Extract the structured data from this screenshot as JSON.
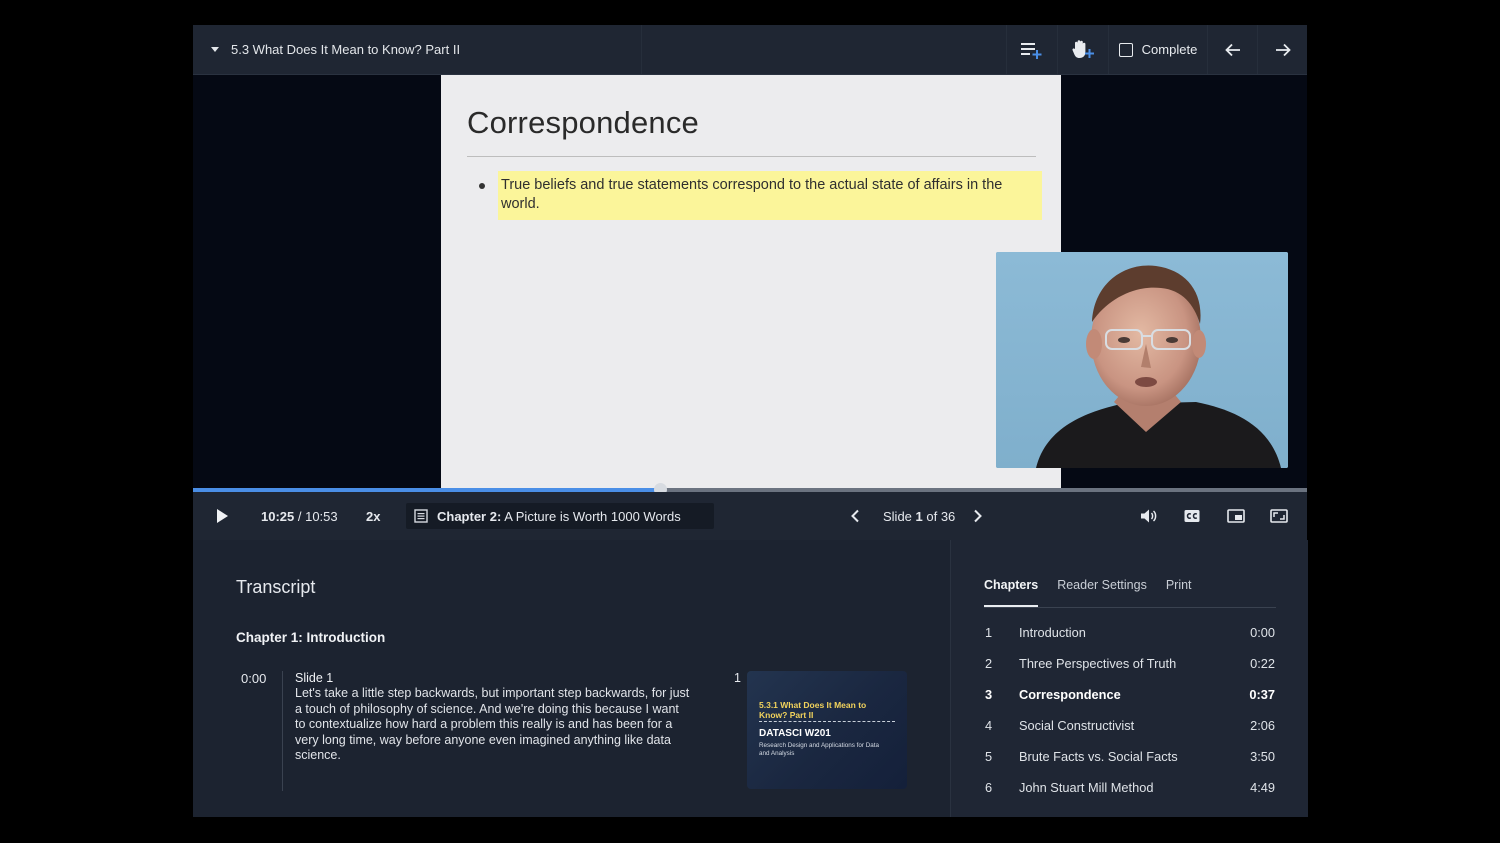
{
  "lesson": {
    "title": "5.3 What Does It Mean to Know? Part II",
    "complete_label": "Complete"
  },
  "slide": {
    "title": "Correspondence",
    "bullet": "True beliefs and true statements correspond to the actual state of affairs in the world."
  },
  "player": {
    "current_time": "10:25",
    "separator": " / ",
    "duration": "10:53",
    "progress": 0.42,
    "speed": "2x",
    "chapter_prefix": "Chapter 2:",
    "chapter_title": " A Picture is Worth 1000 Words",
    "slide_word": "Slide ",
    "slide_current": "1",
    "slide_of": " of 36"
  },
  "transcript": {
    "heading": "Transcript",
    "chapter_heading": "Chapter 1: Introduction",
    "entry": {
      "time": "0:00",
      "slide_label": "Slide 1",
      "text": "Let's take a little step backwards, but important step backwards, for just a touch of philosophy of science. And we're doing this because I want to contextualize how hard a problem this really is and has been for a very long time, way before anyone even imagined anything like data science.",
      "slide_number": "1",
      "thumb_title": "5.3.1 What Does It Mean to Know? Part II",
      "thumb_course": "DATASCI W201",
      "thumb_subtitle": "Research Design and Applications for Data and Analysis"
    }
  },
  "side_panel": {
    "tabs": [
      "Chapters",
      "Reader Settings",
      "Print"
    ],
    "chapters": [
      {
        "num": "1",
        "title": "Introduction",
        "time": "0:00"
      },
      {
        "num": "2",
        "title": "Three Perspectives of Truth",
        "time": "0:22"
      },
      {
        "num": "3",
        "title": "Correspondence",
        "time": "0:37"
      },
      {
        "num": "4",
        "title": "Social Constructivist",
        "time": "2:06"
      },
      {
        "num": "5",
        "title": "Brute Facts vs. Social Facts",
        "time": "3:50"
      },
      {
        "num": "6",
        "title": "John Stuart Mill Method",
        "time": "4:49"
      }
    ]
  },
  "colors": {
    "accent_progress": "#4a8ee6",
    "highlight": "#fbf59a",
    "panel_bg": "#1c2330"
  },
  "icons": [
    "chevron-down-icon",
    "add-to-playlist-icon",
    "raise-hand-icon",
    "checkbox-icon",
    "arrow-left-icon",
    "arrow-right-icon",
    "play-icon",
    "transcript-icon",
    "chevron-left-icon",
    "chevron-right-icon",
    "volume-icon",
    "closed-captions-icon",
    "picture-in-picture-icon",
    "fullscreen-icon"
  ]
}
